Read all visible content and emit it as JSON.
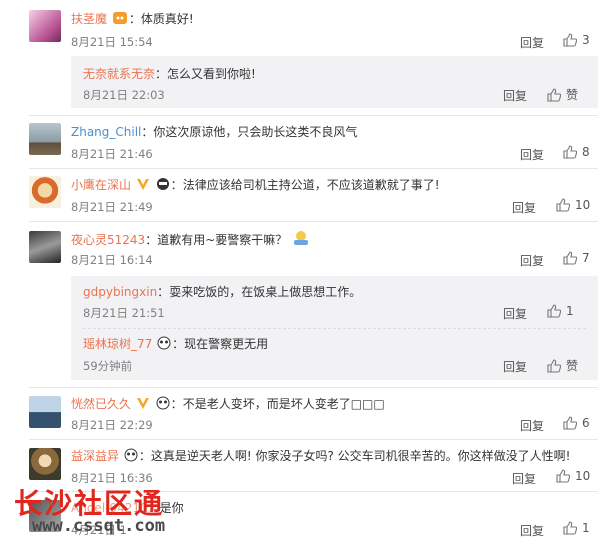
{
  "labels": {
    "reply": "回复",
    "like_zan": "赞"
  },
  "comments": [
    {
      "user": "扶茎魔",
      "sep": "：",
      "text": "体质真好!",
      "time": "8月21日 15:54",
      "likes": "3"
    },
    {
      "user": "Zhang_Chill",
      "sep": "：",
      "text": "你这次原谅他，只会助长这类不良风气",
      "time": "8月21日 21:46",
      "likes": "8"
    },
    {
      "user": "小鹰在深山",
      "sep": "：",
      "text": "法律应该给司机主持公道，不应该道歉就了事了!",
      "time": "8月21日 21:49",
      "likes": "10"
    },
    {
      "user": "夜心灵51243",
      "sep": "：",
      "text": "道歉有用~要警察干嘛？",
      "time": "8月21日 16:14",
      "likes": "7"
    },
    {
      "user": "恍然已久久",
      "sep": "：",
      "text": "不是老人变坏，而是坏人变老了□□□",
      "time": "8月21日 22:29",
      "likes": "6"
    },
    {
      "user": "益深益异",
      "sep": "：",
      "text": "这真是逆天老人啊! 你家没子女吗? 公交车司机很辛苦的。你这样做没了人性啊!",
      "time": "8月21日 16:36",
      "likes": "10"
    },
    {
      "user": "Angel-94210",
      "sep": "：",
      "text": "是你",
      "time": "4月21日 1",
      "likes": "1"
    }
  ],
  "replies": [
    {
      "user": "无奈就系无奈",
      "sep": "：",
      "text": "怎么又看到你啦!",
      "time": "8月21日 22:03"
    },
    {
      "user": "gdpybingxin",
      "sep": "：",
      "text": "耍来吃饭的，在饭桌上做思想工作。",
      "time": "8月21日 21:51",
      "likes": "1"
    },
    {
      "user": "瑶林琼树_77",
      "sep": "：",
      "text": "现在警察更无用",
      "time": "59分钟前"
    }
  ],
  "watermark": {
    "title": "长沙社区通",
    "url": "www.cssqt.com"
  },
  "colors": {
    "username": "#eb7350",
    "time": "#808080",
    "reply_bg": "#f2f2f5",
    "watermark_red": "#e1271d"
  }
}
